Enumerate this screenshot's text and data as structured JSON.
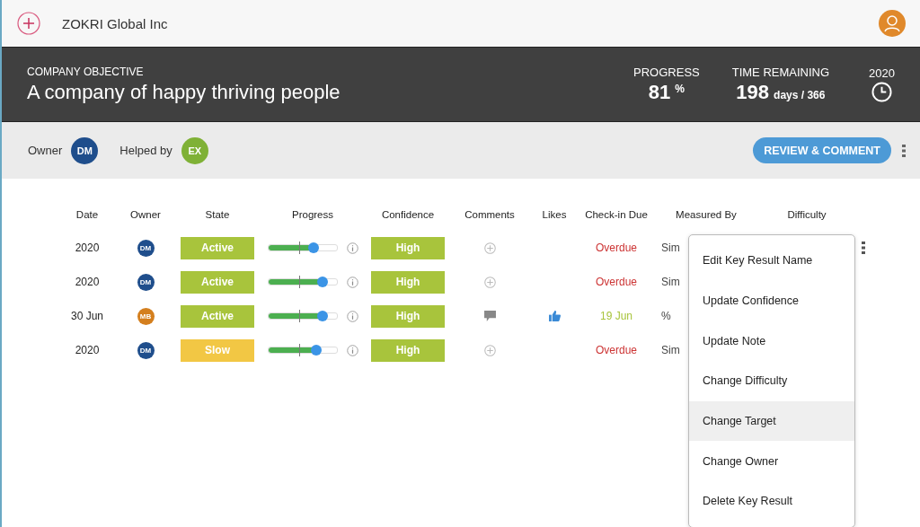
{
  "header": {
    "org_name": "ZOKRI Global Inc"
  },
  "objective": {
    "label": "COMPANY OBJECTIVE",
    "title": "A company of happy thriving people",
    "progress_label": "PROGRESS",
    "progress_value": "81",
    "progress_unit": "%",
    "time_label": "TIME REMAINING",
    "time_value": "198",
    "time_unit": "days / 366",
    "year": "2020"
  },
  "people": {
    "owner_label": "Owner",
    "owner": {
      "initials": "DM",
      "color": "#1f4e8c"
    },
    "helped_label": "Helped by",
    "helper": {
      "initials": "EX",
      "color": "#7fb136"
    },
    "review_button": "REVIEW & COMMENT"
  },
  "table": {
    "columns": [
      "Date",
      "Owner",
      "State",
      "Progress",
      "Confidence",
      "Comments",
      "Likes",
      "Check-in Due",
      "Measured By",
      "Difficulty"
    ],
    "rows": [
      {
        "date": "2020",
        "owner": {
          "initials": "DM",
          "color": "#1f4e8c"
        },
        "state": {
          "label": "Active",
          "color": "#a8c43c"
        },
        "level": 0.67,
        "confidence": "High",
        "comments": {
          "kind": "add"
        },
        "liked": false,
        "due": {
          "label": "Overdue",
          "color": "#cc3333"
        },
        "measured_by": "Sim"
      },
      {
        "date": "2020",
        "owner": {
          "initials": "DM",
          "color": "#1f4e8c"
        },
        "state": {
          "label": "Active",
          "color": "#a8c43c"
        },
        "level": 0.8,
        "confidence": "High",
        "comments": {
          "kind": "add"
        },
        "liked": false,
        "due": {
          "label": "Overdue",
          "color": "#cc3333"
        },
        "measured_by": "Sim"
      },
      {
        "date": "30 Jun",
        "owner": {
          "initials": "MB",
          "color": "#d47f1e"
        },
        "state": {
          "label": "Active",
          "color": "#a8c43c"
        },
        "level": 0.79,
        "confidence": "High",
        "comments": {
          "kind": "comment"
        },
        "liked": true,
        "due": {
          "label": "19 Jun",
          "color": "#a8c43c"
        },
        "measured_by": "%"
      },
      {
        "date": "2020",
        "owner": {
          "initials": "DM",
          "color": "#1f4e8c"
        },
        "state": {
          "label": "Slow",
          "color": "#f2c744"
        },
        "level": 0.71,
        "confidence": "High",
        "comments": {
          "kind": "add"
        },
        "liked": false,
        "due": {
          "label": "Overdue",
          "color": "#cc3333"
        },
        "measured_by": "Sim"
      }
    ]
  },
  "menu": {
    "items": [
      {
        "label": "Edit Key Result Name",
        "selected": false
      },
      {
        "label": "Update Confidence",
        "selected": false
      },
      {
        "label": "Update Note",
        "selected": false
      },
      {
        "label": "Change Difficulty",
        "selected": false
      },
      {
        "label": "Change Target",
        "selected": true
      },
      {
        "label": "Change Owner",
        "selected": false
      },
      {
        "label": "Delete Key Result",
        "selected": false
      }
    ]
  }
}
